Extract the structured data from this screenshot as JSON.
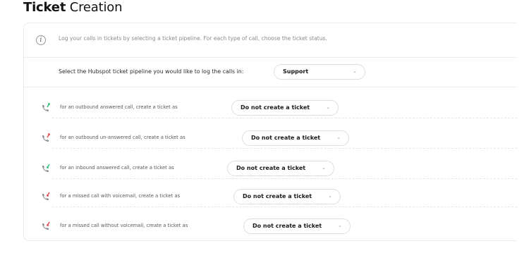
{
  "page": {
    "title_bold": "Ticket",
    "title_rest": " Creation"
  },
  "info": {
    "icon": "info-icon",
    "text": "Log your calls in tickets by selecting a ticket pipeline. For each type of call, choose the ticket status."
  },
  "pipeline": {
    "label": "Select the Hubspot ticket pipeline you would like to log the calls in:",
    "selected": "Support"
  },
  "rules": [
    {
      "label": "for an outbound answered call, create a ticket as",
      "icon": "outbound-call-icon",
      "selected": "Do not create a ticket"
    },
    {
      "label": "for an outbound un-answered call, create a ticket as",
      "icon": "outbound-missed-call-icon",
      "selected": "Do not create a ticket"
    },
    {
      "label": "for an inbound answered call, create a ticket as",
      "icon": "inbound-call-icon",
      "selected": "Do not create a ticket"
    },
    {
      "label": "for a missed call with voicemail, create a ticket as",
      "icon": "missed-call-voicemail-icon",
      "selected": "Do not create a ticket"
    },
    {
      "label": "for a missed call without voicemail, create a ticket as",
      "icon": "missed-call-icon",
      "selected": "Do not create a ticket"
    }
  ],
  "colors": {
    "phone": "#8a8f98",
    "arrow_green": "#2fbf71",
    "arrow_red": "#e5484d"
  }
}
